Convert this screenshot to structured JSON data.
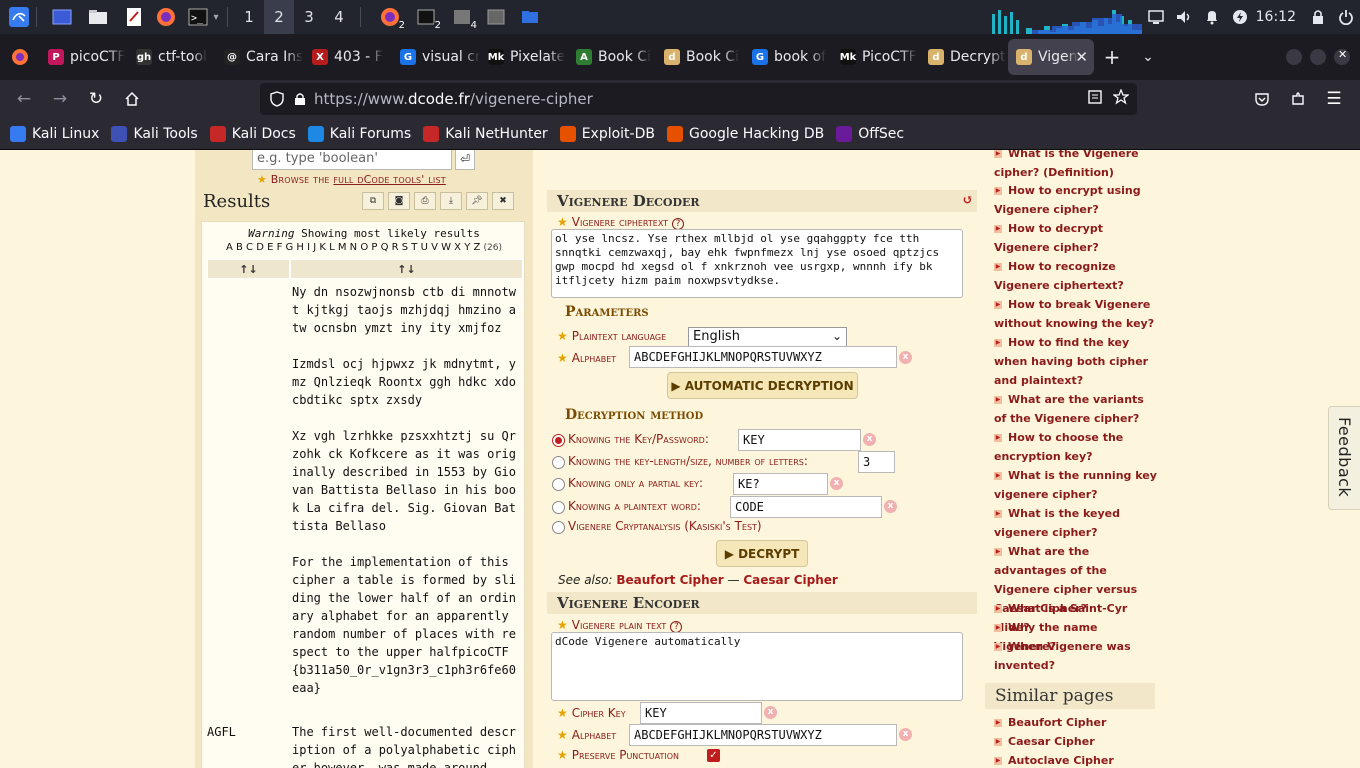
{
  "taskbar": {
    "workspaces": [
      "1",
      "2",
      "3",
      "4"
    ],
    "active_workspace": "2",
    "badges": [
      "2",
      "2",
      "4"
    ],
    "clock": "16:12"
  },
  "tabs": [
    {
      "label": "picoCTF",
      "color": "#c2185b",
      "icon": "P"
    },
    {
      "label": "ctf-tool",
      "color": "#333333",
      "icon": "gh"
    },
    {
      "label": "Cara Ins",
      "color": "#222222",
      "icon": "@"
    },
    {
      "label": "403 - F",
      "color": "#b71c1c",
      "icon": "X"
    },
    {
      "label": "visual cr",
      "color": "#1a73e8",
      "icon": "G"
    },
    {
      "label": "Pixelate",
      "color": "#111111",
      "icon": "Mk"
    },
    {
      "label": "Book Ci",
      "color": "#2e7d32",
      "icon": "A"
    },
    {
      "label": "Book Ci",
      "color": "#d9b36b",
      "icon": "d"
    },
    {
      "label": "book of",
      "color": "#1a73e8",
      "icon": "G"
    },
    {
      "label": "PicoCTF",
      "color": "#111111",
      "icon": "Mk"
    },
    {
      "label": "Decrypt",
      "color": "#d9b36b",
      "icon": "d"
    },
    {
      "label": "Vigen",
      "color": "#d9b36b",
      "icon": "d"
    }
  ],
  "url": {
    "scheme": "https://www.",
    "host": "dcode.fr",
    "path": "/vigenere-cipher"
  },
  "bookmarks": [
    {
      "label": "Kali Linux",
      "color": "#367bf0"
    },
    {
      "label": "Kali Tools",
      "color": "#3f51b5"
    },
    {
      "label": "Kali Docs",
      "color": "#c62828"
    },
    {
      "label": "Kali Forums",
      "color": "#1e88e5"
    },
    {
      "label": "Kali NetHunter",
      "color": "#c62828"
    },
    {
      "label": "Exploit-DB",
      "color": "#e65100"
    },
    {
      "label": "Google Hacking DB",
      "color": "#e65100"
    },
    {
      "label": "OffSec",
      "color": "#6a1b9a"
    }
  ],
  "left": {
    "search_placeholder": "e.g. type 'boolean'",
    "search_go": "⏎",
    "browse_prefix": "Browse the ",
    "browse_link": "full dCode tools' list",
    "results_title": "Results",
    "warning_label": "Warning",
    "warning_text": " Showing most likely results",
    "alphabet": "A B C D E F G H I J K L M N O P Q R S T U V W X Y Z",
    "alphabet_count": "(26)",
    "sort_symbol": "↑↓",
    "rows": [
      {
        "key": "",
        "text": "Ny dn nsozwjnonsb ctb di mnnotwt kjtkgj taojs mzhjdqj hmzino atw ocnsbn ymzt iny ity xmjfoz\n\nIzmdsl ocj hjpwxz jk mdnytmt, ymz Qnlzieqk Roontx ggh hdkc xdocbdtikc sptx zxsdy\n\nXz vgh lzrhkke pzsxxhtztj su Qrzohk ck Kofkcere as it was originally described in 1553 by Giovan Battista Bellaso in his book La cifra del. Sig. Giovan Battista Bellaso\n\nFor the implementation of this cipher a table is formed by sliding the lower half of an ordinary alphabet for an apparently random number of places with respect to the upper halfpicoCTF{b311a50_0r_v1gn3r3_c1ph3r6fe60eaa}\n\n"
      },
      {
        "key": "AGFL",
        "text": "The first well-documented description of a polyalphabetic cipher however, was made around"
      }
    ]
  },
  "decoder": {
    "title": "Vigenere Decoder",
    "ciphertext_label": "Vigenere ciphertext",
    "ciphertext": "ol yse lncsz. Yse rthex mllbjd ol yse gqahggpty fce tth snnqtki cemzwaxqj, bay ehk fwpnfmezx lnj yse osoed qptzjcs gwp mocpd hd xegsd ol f xnkrznoh vee usrgxp, wnnnh ify bk itfljcety hizm paim noxwpsvtydkse.",
    "params_title": "Parameters",
    "lang_label": "Plaintext language",
    "lang_value": "English",
    "alphabet_label": "Alphabet",
    "alphabet_value": "ABCDEFGHIJKLMNOPQRSTUVWXYZ",
    "auto_button": "▶ AUTOMATIC DECRYPTION",
    "method_title": "Decryption method",
    "methods": [
      {
        "label": "Knowing the Key/Password:",
        "value": "KEY",
        "selected": true
      },
      {
        "label": "Knowing the key-length/size, number of letters:",
        "value": "3",
        "selected": false
      },
      {
        "label": "Knowing only a partial key:",
        "value": "KE?",
        "selected": false
      },
      {
        "label": "Knowing a plaintext word:",
        "value": "CODE",
        "selected": false
      },
      {
        "label": "Vigenere Cryptanalysis (Kasiski's Test)",
        "value": "",
        "selected": false
      }
    ],
    "decrypt_button": "▶ DECRYPT",
    "see_also_label": "See also:",
    "see_also_1": "Beaufort Cipher",
    "see_also_sep": " — ",
    "see_also_2": "Caesar Cipher"
  },
  "encoder": {
    "title": "Vigenere Encoder",
    "plain_label": "Vigenere plain text",
    "plain_value": "dCode Vigenere automatically",
    "key_label": "Cipher Key",
    "key_value": "KEY",
    "alphabet_label": "Alphabet",
    "alphabet_value": "ABCDEFGHIJKLMNOPQRSTUVWXYZ",
    "punct_label": "Preserve Punctuation"
  },
  "faq": [
    "What is the Vigenere cipher? (Definition)",
    "How to encrypt using Vigenere cipher?",
    "How to decrypt Vigenere cipher?",
    "How to recognize Vigenere ciphertext?",
    "How to break Vigenere without knowing the key?",
    "How to find the key when having both cipher and plaintext?",
    "What are the variants of the Vigenere cipher?",
    "How to choose the encryption key?",
    "What is the running key vigenere cipher?",
    "What is the keyed vigenere cipher?",
    "What are the advantages of the Vigenere cipher versus Caesar Cipher?",
    "What is a Saint-Cyr slide?",
    "Why the name Vigenere?",
    "When Vigenere was invented?"
  ],
  "similar": {
    "title": "Similar pages",
    "items": [
      "Beaufort Cipher",
      "Caesar Cipher",
      "Autoclave Cipher"
    ]
  },
  "feedback": "Feedback"
}
